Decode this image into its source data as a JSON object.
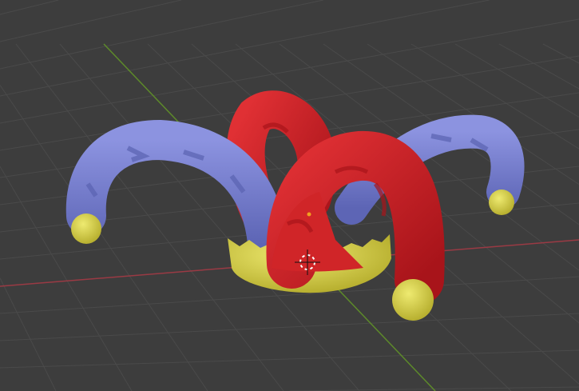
{
  "viewport": {
    "background": "#3d3d3d",
    "grid_color": "#4a4a4a",
    "x_axis_color": "#9a3a44",
    "y_axis_color": "#5d8a2a"
  },
  "model": {
    "blue_color": "#7e85d4",
    "blue_dark": "#5a62b0",
    "red_color": "#d8282a",
    "red_dark": "#a8141a",
    "yellow_color": "#d9d54a",
    "yellow_dark": "#b8b030"
  },
  "icons": {
    "cursor": "3d-cursor-icon",
    "origin": "object-origin-icon"
  }
}
